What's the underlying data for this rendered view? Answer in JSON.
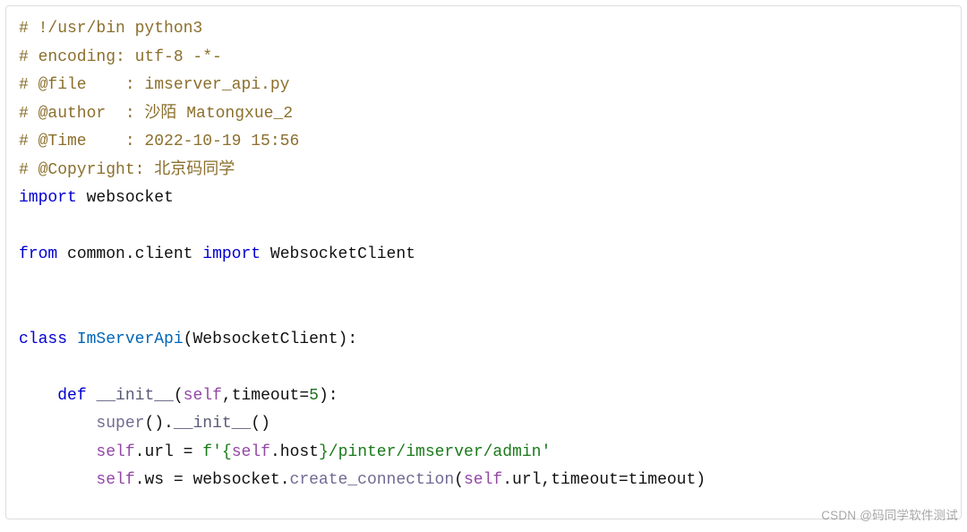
{
  "code": {
    "c1": "# !/usr/bin python3",
    "c2": "# encoding: utf-8 -*-",
    "c3a": "# @file",
    "c3b": "    : imserver_api.py",
    "c4a": "# @author",
    "c4b": "  : 沙陌 Matongxue_2",
    "c5a": "# @Time",
    "c5b": "    : 2022-10-19 15:56",
    "c6a": "# @Copyright:",
    "c6b": " 北京码同学",
    "kw_import": "import",
    "kw_from": "from",
    "kw_class": "class",
    "kw_def": "def",
    "mod_websocket": "websocket",
    "mod_common": "common",
    "mod_client": "client",
    "mod_wsclient": "WebsocketClient",
    "class_name": "ImServerApi",
    "fn_init": "__init__",
    "kw_self": "self",
    "param_timeout": "timeout",
    "num_5": "5",
    "fn_super": "super",
    "attr_url": "url",
    "attr_host": "host",
    "attr_ws": "ws",
    "fn_createconn": "create_connection",
    "str_prefix": "f",
    "str_open": "'",
    "str_brace_open": "{",
    "str_brace_close": "}",
    "str_path": "/pinter/imserver/admin",
    "str_close": "'"
  },
  "watermark": "CSDN @码同学软件测试"
}
